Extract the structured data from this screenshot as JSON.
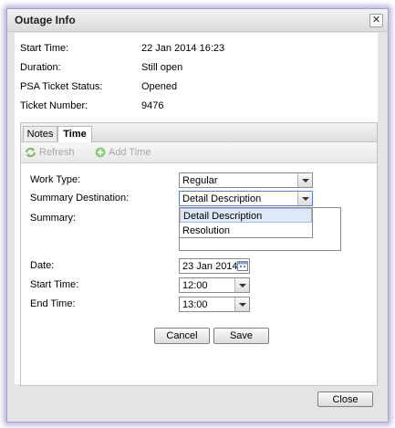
{
  "dialog": {
    "title": "Outage Info"
  },
  "info": {
    "start_time_label": "Start Time:",
    "start_time_value": "22 Jan 2014 16:23",
    "duration_label": "Duration:",
    "duration_value": "Still open",
    "psa_status_label": "PSA Ticket Status:",
    "psa_status_value": "Opened",
    "ticket_number_label": "Ticket Number:",
    "ticket_number_value": "9476"
  },
  "tabs": [
    {
      "label": "Notes"
    },
    {
      "label": "Time"
    }
  ],
  "toolbar": {
    "refresh_label": "Refresh",
    "add_time_label": "Add Time"
  },
  "form": {
    "work_type_label": "Work Type:",
    "work_type_value": "Regular",
    "summary_dest_label": "Summary Destination:",
    "summary_dest_value": "Detail Description",
    "summary_label": "Summary:",
    "dropdown_options": [
      "Detail Description",
      "Resolution"
    ],
    "date_label": "Date:",
    "date_value": "23 Jan 2014",
    "start_time_label": "Start Time:",
    "start_time_value": "12:00",
    "end_time_label": "End Time:",
    "end_time_value": "13:00",
    "cancel_label": "Cancel",
    "save_label": "Save"
  },
  "footer": {
    "close_label": "Close"
  }
}
